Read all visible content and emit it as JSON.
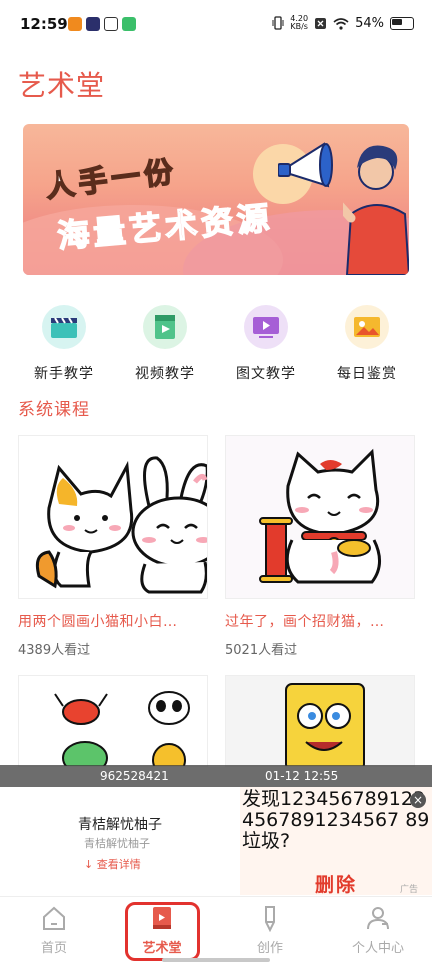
{
  "status_bar": {
    "time": "12:59",
    "net_speed_value": "4.20",
    "net_speed_unit": "KB/s",
    "battery": "54%"
  },
  "page": {
    "title": "艺术堂"
  },
  "banner": {
    "line1": "人手一份",
    "line2": "海量艺术资源"
  },
  "quick_entries": [
    {
      "label": "新手教学",
      "icon": "clapperboard-icon",
      "bg": "#d7f4f1"
    },
    {
      "label": "视频教学",
      "icon": "video-file-icon",
      "bg": "#dcf4e4"
    },
    {
      "label": "图文教学",
      "icon": "tv-play-icon",
      "bg": "#eee0f7"
    },
    {
      "label": "每日鉴赏",
      "icon": "picture-icon",
      "bg": "#fdf1d8"
    }
  ],
  "section": {
    "title": "系统课程"
  },
  "courses": [
    {
      "title": "用两个圆画小猫和小白…",
      "views": "4389人看过"
    },
    {
      "title": "过年了，画个招财猫，…",
      "views": "5021人看过"
    }
  ],
  "ad": {
    "id": "962528421",
    "time": "01-12 12:55",
    "name": "青桔解忧柚子",
    "sub": "青桔解忧柚子",
    "detail": "查看详情",
    "image_text": "发现1234567891234567891234567 89垃圾?",
    "image_button": "删除",
    "tag": "广告"
  },
  "bottom_nav": {
    "items": [
      {
        "label": "首页",
        "icon": "home-icon"
      },
      {
        "label": "艺术堂",
        "icon": "book-icon"
      },
      {
        "label": "创作",
        "icon": "pen-icon"
      },
      {
        "label": "个人中心",
        "icon": "profile-icon"
      }
    ],
    "active_index": 1
  },
  "colors": {
    "accent": "#e65a4c"
  }
}
